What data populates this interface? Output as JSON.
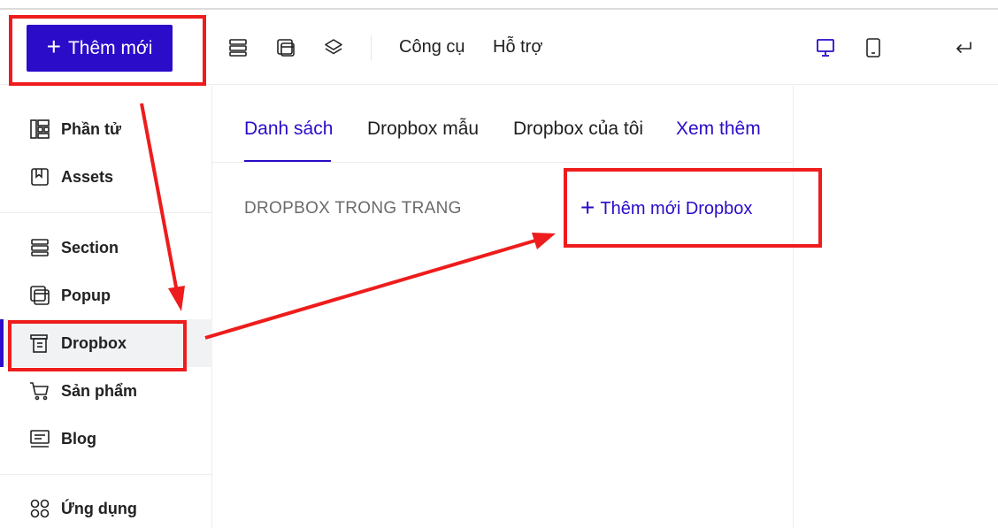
{
  "header": {
    "add_button_label": "Thêm mới",
    "menu": [
      "Công cụ",
      "Hỗ trợ"
    ],
    "icons": [
      "sections-icon",
      "popup-window-icon",
      "layers-icon",
      "desktop-icon",
      "mobile-icon",
      "back-arrow-icon"
    ]
  },
  "sidebar": {
    "items": [
      {
        "label": "Phần tử",
        "icon": "elements-icon"
      },
      {
        "label": "Assets",
        "icon": "assets-icon"
      },
      {
        "label": "Section",
        "icon": "section-icon"
      },
      {
        "label": "Popup",
        "icon": "popup-icon"
      },
      {
        "label": "Dropbox",
        "icon": "dropbox-icon",
        "active": true
      },
      {
        "label": "Sản phẩm",
        "icon": "cart-icon"
      },
      {
        "label": "Blog",
        "icon": "blog-icon"
      },
      {
        "label": "Ứng dụng",
        "icon": "apps-icon"
      }
    ]
  },
  "panel": {
    "tabs": [
      "Danh sách",
      "Dropbox mẫu",
      "Dropbox của tôi",
      "Xem thêm"
    ],
    "section_label": "DROPBOX TRONG TRANG",
    "add_dropbox_label": "Thêm mới Dropbox"
  },
  "colors": {
    "accent": "#2a0cc9",
    "annotation_red": "#ee1c1c",
    "active_bg": "#f1f2f4"
  }
}
